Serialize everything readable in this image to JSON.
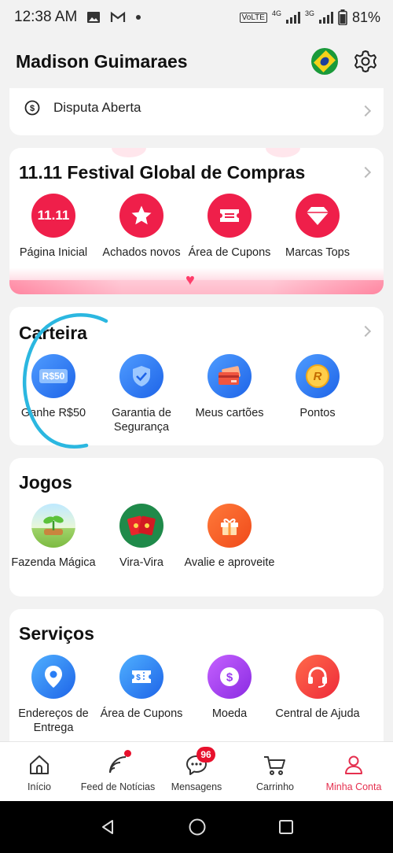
{
  "status_bar": {
    "time": "12:38 AM",
    "icons": [
      "image-icon",
      "gmail-icon",
      "dot-icon"
    ],
    "network": "VoLTE",
    "net1": "4G",
    "net2": "3G",
    "battery": "81%"
  },
  "header": {
    "user_name": "Madison Guimaraes",
    "flag_icon": "brazil-flag-icon",
    "settings_icon": "gear-icon"
  },
  "dispute": {
    "label": "Disputa Aberta",
    "icon": "dollar-cycle-icon"
  },
  "festival": {
    "title": "11.11 Festival Global de Compras",
    "items": [
      {
        "label": "Página Inicial",
        "icon_text": "11.11",
        "icon": "festival-home-icon"
      },
      {
        "label": "Achados novos",
        "icon": "star-icon"
      },
      {
        "label": "Área de Cupons",
        "icon": "ticket-icon"
      },
      {
        "label": "Marcas Tops",
        "icon": "diamond-icon"
      }
    ]
  },
  "wallet": {
    "title": "Carteira",
    "items": [
      {
        "label": "Ganhe R$50",
        "icon_text": "R$50",
        "icon": "earn-cash-icon"
      },
      {
        "label": "Garantia de Segurança",
        "icon": "shield-check-icon"
      },
      {
        "label": "Meus cartões",
        "icon": "cards-icon"
      },
      {
        "label": "Pontos",
        "icon_text": "R",
        "icon": "points-coin-icon"
      }
    ]
  },
  "games": {
    "title": "Jogos",
    "items": [
      {
        "label": "Fazenda Mágica",
        "icon": "farm-sprout-icon"
      },
      {
        "label": "Vira-Vira",
        "icon": "flip-cards-icon"
      },
      {
        "label": "Avalie e aproveite",
        "icon": "gift-icon"
      }
    ]
  },
  "services": {
    "title": "Serviços",
    "items": [
      {
        "label": "Endereços de Entrega",
        "icon": "location-pin-icon"
      },
      {
        "label": "Área de Cupons",
        "icon": "coupon-icon"
      },
      {
        "label": "Moeda",
        "icon": "currency-icon"
      },
      {
        "label": "Central de Ajuda",
        "icon": "headset-icon"
      }
    ]
  },
  "bottom_nav": {
    "items": [
      {
        "label": "Início",
        "icon": "home-icon"
      },
      {
        "label": "Feed de Notícias",
        "icon": "feed-icon"
      },
      {
        "label": "Mensagens",
        "icon": "chat-icon",
        "badge": "96"
      },
      {
        "label": "Carrinho",
        "icon": "cart-icon"
      },
      {
        "label": "Minha Conta",
        "icon": "user-icon",
        "active": true
      }
    ]
  },
  "colors": {
    "accent": "#e5304f",
    "festival_red": "#ef1f4a",
    "wallet_blue": "#2a7ef5",
    "annotation_scribble": "#2bb7e0"
  }
}
